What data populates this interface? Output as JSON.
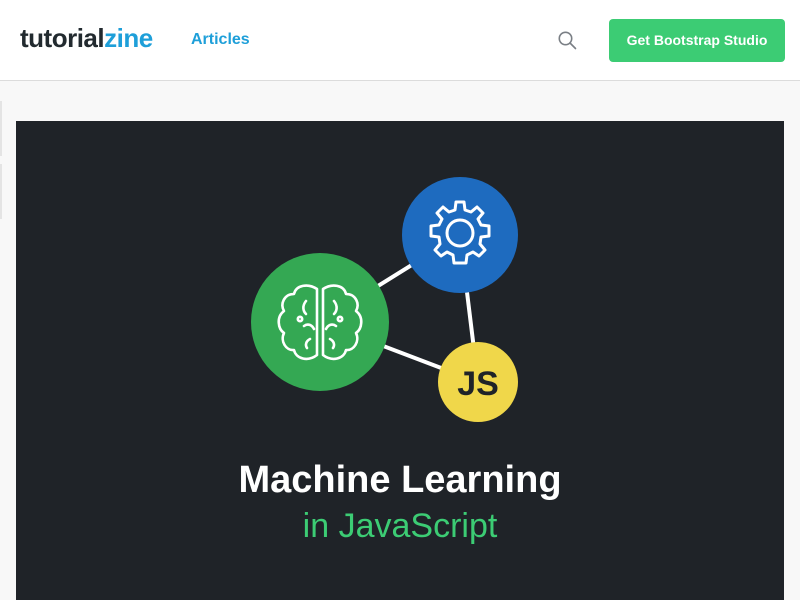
{
  "header": {
    "logo_part1": "tutorial",
    "logo_part2": "zine",
    "nav_articles": "Articles",
    "cta_label": "Get Bootstrap Studio",
    "search_icon": "search-icon"
  },
  "hero": {
    "title": "Machine Learning",
    "subtitle": "in JavaScript",
    "js_badge": "JS",
    "icons": [
      "brain-icon",
      "gear-icon",
      "js-icon"
    ],
    "colors": {
      "background": "#1f2328",
      "brain": "#34a853",
      "gear": "#1e6bbf",
      "js": "#f0d74a",
      "accent": "#3ccc74"
    }
  }
}
